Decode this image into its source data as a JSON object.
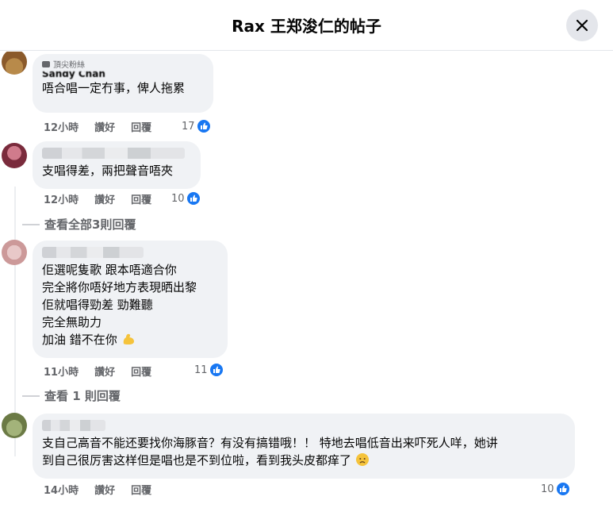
{
  "header": {
    "title": "Rax 王郑浚仁的帖子"
  },
  "comments": [
    {
      "name_partial": "Sandy Chan",
      "badge": "頂尖粉絲",
      "text": "唔合唱一定冇事，俾人拖累",
      "time": "12小時",
      "like_label": "讚好",
      "reply_label": "回覆",
      "reactions": "17"
    },
    {
      "text": "支唱得差，兩把聲音唔夾",
      "time": "12小時",
      "like_label": "讚好",
      "reply_label": "回覆",
      "reactions": "10"
    },
    {
      "lines": [
        "佢選呢隻歌 跟本唔適合你",
        "完全將你唔好地方表現晒出黎",
        "佢就唱得勁差 勁難聽",
        "完全無助力",
        "加油 錯不在你"
      ],
      "time": "11小時",
      "like_label": "讚好",
      "reply_label": "回覆",
      "reactions": "11"
    },
    {
      "lines": [
        "支自己高音不能还要找你海豚音？有没有搞错哦！！ 特地去唱低音出来吓死人咩，她讲",
        "到自己很厉害这样但是唱也是不到位啦，看到我头皮都痒了"
      ],
      "time": "14小時",
      "like_label": "讚好",
      "reply_label": "回覆",
      "reactions": "10"
    }
  ],
  "view_replies": [
    {
      "label": "查看全部3則回覆"
    },
    {
      "label": "查看 1 則回覆"
    }
  ],
  "colors": {
    "like_blue": "#1877f2",
    "bubble": "#f0f2f5",
    "meta_text": "#65676b"
  },
  "icons": {
    "close": "close-icon",
    "like": "thumbs-up-icon",
    "flex_emoji": "flexed-biceps-emoji",
    "sad_emoji": "worried-face-emoji"
  }
}
